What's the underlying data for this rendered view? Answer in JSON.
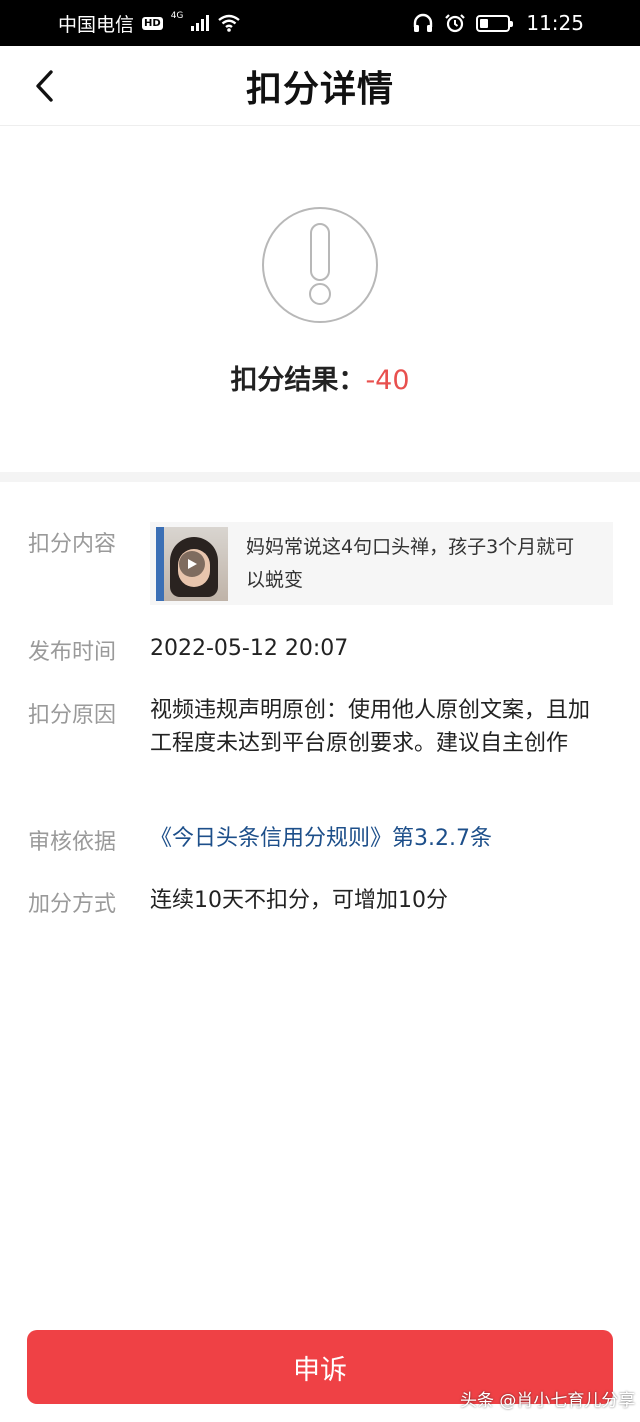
{
  "status_bar": {
    "carrier": "中国电信",
    "hd_badge": "HD",
    "network_type": "4G",
    "time": "11:25",
    "icons": [
      "hd-icon",
      "signal-icon",
      "wifi-icon",
      "headphones-icon",
      "alarm-icon",
      "battery-icon"
    ],
    "battery_level": 0.28
  },
  "nav": {
    "back_icon": "chevron-left-icon",
    "title": "扣分详情"
  },
  "result": {
    "icon": "exclamation-circle-icon",
    "label": "扣分结果：",
    "value": "-40",
    "value_color": "#e8504e"
  },
  "details": {
    "content": {
      "label": "扣分内容",
      "title": "妈妈常说这4句口头禅，孩子3个月就可以蜕变",
      "thumbnail_icon": "video-play-icon"
    },
    "publish_time": {
      "label": "发布时间",
      "value": "2022-05-12 20:07"
    },
    "reason": {
      "label": "扣分原因",
      "value": "视频违规声明原创：使用他人原创文案，且加工程度未达到平台原创要求。建议自主创作"
    },
    "basis": {
      "label": "审核依据",
      "value": "《今日头条信用分规则》第3.2.7条",
      "link_color": "#1d4f8a"
    },
    "bonus": {
      "label": "加分方式",
      "value": "连续10天不扣分，可增加10分"
    }
  },
  "appeal_button": {
    "label": "申诉",
    "color": "#ef4145"
  },
  "watermark": "头条 @肖小七育儿分享"
}
